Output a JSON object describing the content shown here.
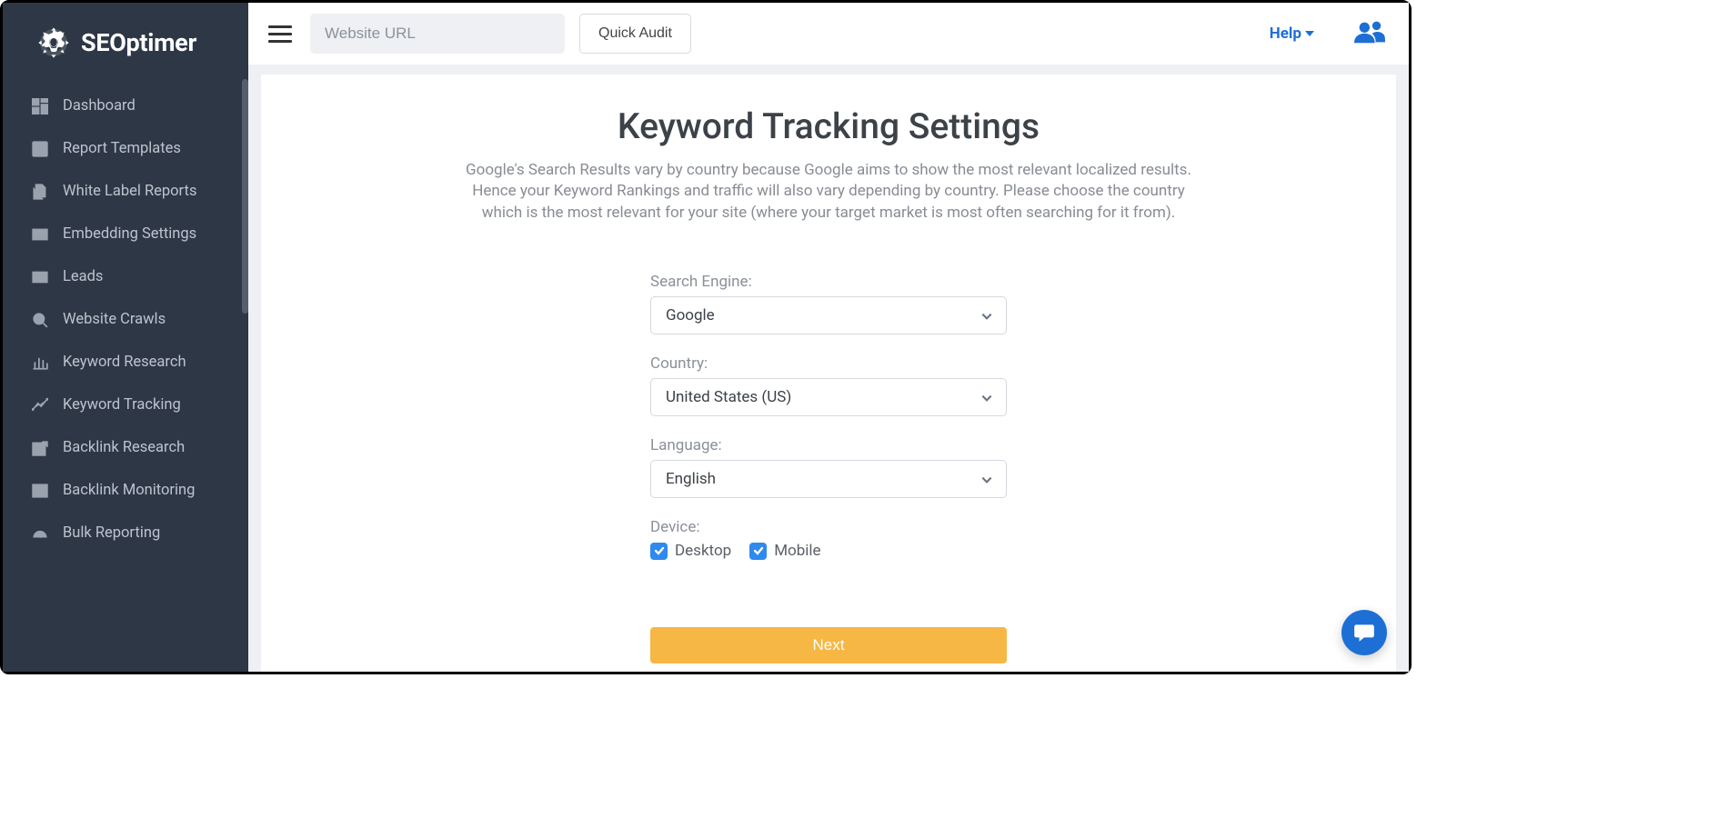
{
  "brand": {
    "name": "SEOptimer"
  },
  "sidebar": {
    "items": [
      {
        "label": "Dashboard"
      },
      {
        "label": "Report Templates"
      },
      {
        "label": "White Label Reports"
      },
      {
        "label": "Embedding Settings"
      },
      {
        "label": "Leads"
      },
      {
        "label": "Website Crawls"
      },
      {
        "label": "Keyword Research"
      },
      {
        "label": "Keyword Tracking"
      },
      {
        "label": "Backlink Research"
      },
      {
        "label": "Backlink Monitoring"
      },
      {
        "label": "Bulk Reporting"
      }
    ]
  },
  "topbar": {
    "url_placeholder": "Website URL",
    "audit_label": "Quick Audit",
    "help_label": "Help"
  },
  "page": {
    "title": "Keyword Tracking Settings",
    "description": "Google's Search Results vary by country because Google aims to show the most relevant localized results. Hence your Keyword Rankings and traffic will also vary depending by country. Please choose the country which is the most relevant for your site (where your target market is most often searching for it from)."
  },
  "form": {
    "search_engine_label": "Search Engine:",
    "search_engine_value": "Google",
    "country_label": "Country:",
    "country_value": "United States (US)",
    "language_label": "Language:",
    "language_value": "English",
    "device_label": "Device:",
    "device_desktop": "Desktop",
    "device_mobile": "Mobile",
    "next_label": "Next"
  },
  "colors": {
    "sidebar_bg": "#2d3746",
    "primary_blue": "#1d6fd6",
    "cta_orange": "#f6b744",
    "checkbox_blue": "#2f89ee"
  }
}
